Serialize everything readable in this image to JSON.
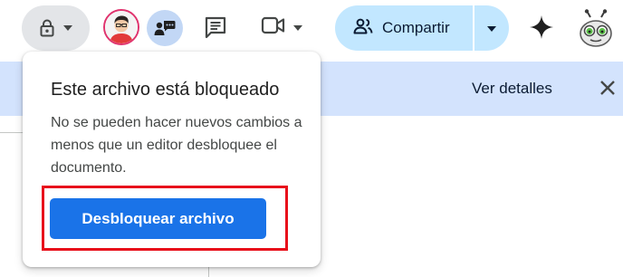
{
  "toolbar": {
    "lock_button": {
      "icon": "lock-icon",
      "dropdown_icon": "caret-down-icon"
    },
    "avatar": {
      "icon": "user-avatar"
    },
    "present_chat_icon": "chat-present-icon",
    "comments_icon": "comments-icon",
    "meet": {
      "icon": "video-camera-icon",
      "dropdown_icon": "caret-down-icon"
    },
    "share": {
      "label": "Compartir",
      "icon": "people-icon",
      "dropdown_icon": "caret-down-icon"
    },
    "gemini_icon": "gemini-sparkle-icon",
    "bee_avatar": "bee-avatar-icon"
  },
  "banner": {
    "details_link": "Ver detalles",
    "close_icon": "close-icon"
  },
  "popover": {
    "title": "Este archivo está bloqueado",
    "body": "No se pueden hacer nuevos cambios a menos que un editor desbloquee el documento.",
    "unlock_button": "Desbloquear archivo"
  },
  "colors": {
    "banner_bg": "#d3e3fd",
    "share_bg": "#c2e7ff",
    "primary_button": "#1a73e8",
    "highlight": "#e8101b",
    "lock_button_bg": "#e3e5e8"
  }
}
